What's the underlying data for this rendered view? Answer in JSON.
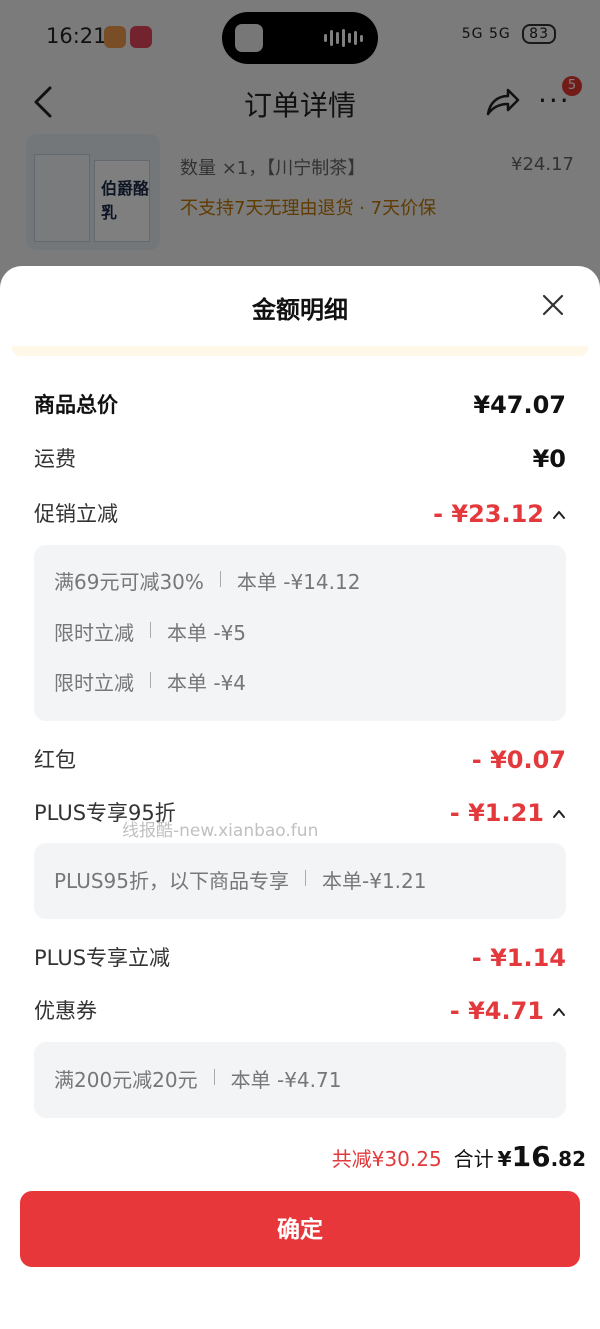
{
  "status_bar": {
    "time": "16:21",
    "network": "5G 5G",
    "battery": "83"
  },
  "navbar": {
    "title": "订单详情",
    "badge_count": "5"
  },
  "product": {
    "image_text": "伯爵酪乳",
    "qty_spec": "数量 ×1，【川宁制茶】",
    "price": "¥24.17",
    "note": "不支持7天无理由退货 · 7天价保"
  },
  "sheet": {
    "title": "金额明细",
    "rows": [
      {
        "label": "商品总价",
        "value": "¥47.07"
      },
      {
        "label": "运费",
        "value": "¥0"
      },
      {
        "label": "促销立减",
        "value": "- ¥23.12"
      },
      {
        "label": "红包",
        "value": "- ¥0.07"
      },
      {
        "label": "PLUS专享95折",
        "value": "- ¥1.21"
      },
      {
        "label": "PLUS专享立减",
        "value": "- ¥1.14"
      },
      {
        "label": "优惠券",
        "value": "- ¥4.71"
      }
    ],
    "promo_details": [
      {
        "name": "满69元可减30%",
        "amount": "本单 -¥14.12"
      },
      {
        "name": "限时立减",
        "amount": "本单 -¥5"
      },
      {
        "name": "限时立减",
        "amount": "本单 -¥4"
      }
    ],
    "plus_details": [
      {
        "name": "PLUS95折，以下商品专享",
        "amount": "本单-¥1.21"
      }
    ],
    "coupon_details": [
      {
        "name": "满200元减20元",
        "amount": "本单 -¥4.71"
      }
    ],
    "watermark": "线报酷-new.xianbao.fun",
    "total_saved": "共减¥30.25",
    "total_label": "合计",
    "total_currency": "¥",
    "total_integer": "16",
    "total_decimal": ".82",
    "confirm_label": "确定"
  },
  "colors": {
    "accent_red": "#e4393c",
    "button_red": "#e8373b",
    "warning_orange": "#c07700"
  }
}
